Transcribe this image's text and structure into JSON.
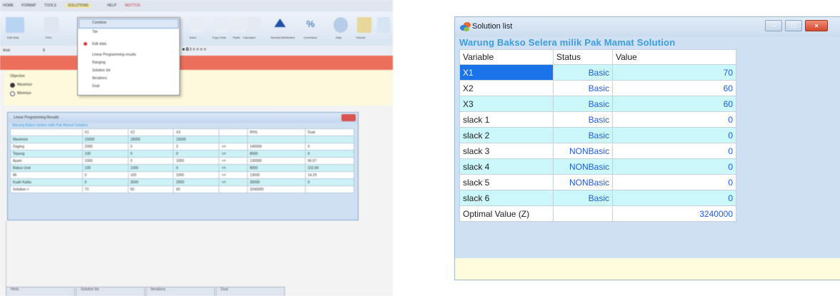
{
  "left_app": {
    "window_title": "",
    "menu": [
      "HOME",
      "FORMAT",
      "TOOLS",
      "SOLUTIONS",
      "HELP",
      "MOTTOS"
    ],
    "ribbon_labels": [
      "Edit Data",
      "Print",
      "Solve",
      "Copy Cells",
      "Paste",
      "Calculator",
      "Normal Distribution",
      "Command",
      "Help",
      "Tutorial"
    ],
    "font_name": "Arial",
    "font_size": "8",
    "alert_text": "",
    "objective": {
      "label": "Objective",
      "options": [
        "Maximize",
        "Minimize"
      ],
      "selected": "Maximize"
    },
    "dropdown_items": [
      "Combine",
      "Tile",
      "Edit data",
      "Linear Programming results",
      "Ranging",
      "Solution list",
      "Iterations",
      "Dual"
    ],
    "lp_results": {
      "window_title": "Linear Programming Results",
      "subtitle": "Warung Bakso Selera milik Pak Mamat Solution",
      "headers": [
        "",
        "X1",
        "X2",
        "X3",
        "",
        "RHS",
        "Dual"
      ],
      "rows": [
        [
          "Maximize",
          "15000",
          "18000",
          "15000",
          "",
          "",
          ""
        ],
        [
          "Daging",
          "2000",
          "0",
          "0",
          "<=",
          "140000",
          "0"
        ],
        [
          "Tepung",
          "100",
          "0",
          "0",
          "<=",
          "8000",
          "0"
        ],
        [
          "Ayam",
          "1000",
          "0",
          "1000",
          "<=",
          "130000",
          "96.57"
        ],
        [
          "Bakso Urat",
          "100",
          "1000",
          "0",
          "<=",
          "8000",
          "102.69"
        ],
        [
          "Mi",
          "0",
          "100",
          "1000",
          "<=",
          "13000",
          "14.29"
        ],
        [
          "Kuah Kaldu",
          "0",
          "3000",
          "2000",
          "<=",
          "30000",
          "0"
        ],
        [
          "Solution->",
          "70",
          "60",
          "60",
          "",
          "3240000",
          ""
        ]
      ]
    },
    "status_cells": [
      "Hints",
      "Solution list",
      "Iterations",
      "Dual"
    ]
  },
  "solution_window": {
    "title": "Solution list",
    "heading": "Warung Bakso Selera milik Pak Mamat Solution",
    "columns": [
      "Variable",
      "Status",
      "Value"
    ],
    "rows": [
      {
        "variable": "X1",
        "status": "Basic",
        "value": "70"
      },
      {
        "variable": "X2",
        "status": "Basic",
        "value": "60"
      },
      {
        "variable": "X3",
        "status": "Basic",
        "value": "60"
      },
      {
        "variable": "slack 1",
        "status": "Basic",
        "value": "0"
      },
      {
        "variable": "slack 2",
        "status": "Basic",
        "value": "0"
      },
      {
        "variable": "slack 3",
        "status": "NONBasic",
        "value": "0"
      },
      {
        "variable": "slack 4",
        "status": "NONBasic",
        "value": "0"
      },
      {
        "variable": "slack 5",
        "status": "NONBasic",
        "value": "0"
      },
      {
        "variable": "slack 6",
        "status": "Basic",
        "value": "0"
      },
      {
        "variable": "Optimal Value (Z)",
        "status": "",
        "value": "3240000"
      }
    ],
    "colors": {
      "heading": "#3b9ee0",
      "value_text": "#1f5ce6",
      "row_highlight": "#ccf8fb",
      "selected_cell": "#1a73e8",
      "footer": "#fffbdc"
    }
  }
}
